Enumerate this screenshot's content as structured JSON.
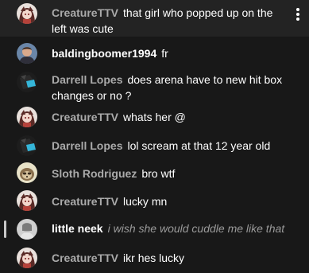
{
  "colors": {
    "background": "#181818",
    "highlight": "#232323",
    "author": "#aaaaaa",
    "message": "#ffffff",
    "italic": "#9a9a9a"
  },
  "messages": [
    {
      "author": "CreatureTTV",
      "text": "that girl who popped up on the left was cute",
      "avatar": "creature-avatar-icon"
    },
    {
      "author": "baldingboomer1994",
      "text": "fr",
      "avatar": "balding-avatar-icon"
    },
    {
      "author": "Darrell Lopes",
      "text": "does arena have to new hit box changes or no ?",
      "avatar": "darrell-avatar-icon"
    },
    {
      "author": "CreatureTTV",
      "text": "whats her @",
      "avatar": "creature-avatar-icon"
    },
    {
      "author": "Darrell Lopes",
      "text": "lol scream at that 12 year old",
      "avatar": "darrell-avatar-icon"
    },
    {
      "author": "Sloth Rodriguez",
      "text": "bro wtf",
      "avatar": "sloth-avatar-icon"
    },
    {
      "author": "CreatureTTV",
      "text": "lucky mn",
      "avatar": "creature-avatar-icon"
    },
    {
      "author": "little neek",
      "text": "i wish she would cuddle me like that",
      "avatar": "neek-avatar-icon"
    },
    {
      "author": "CreatureTTV",
      "text": "ikr hes lucky",
      "avatar": "creature-avatar-icon"
    }
  ]
}
